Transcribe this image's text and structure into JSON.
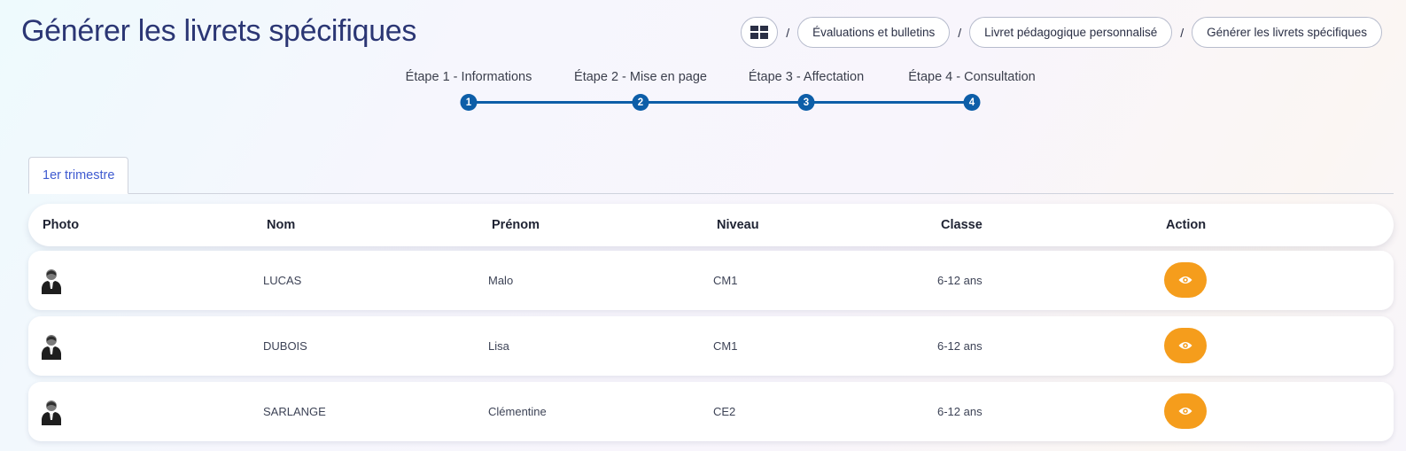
{
  "page": {
    "title": "Générer les livrets spécifiques"
  },
  "breadcrumb": {
    "home_icon": "dashboard-grid-icon",
    "separator": "/",
    "items": [
      {
        "label": "Évaluations et bulletins"
      },
      {
        "label": "Livret pédagogique personnalisé"
      },
      {
        "label": "Générer les livrets spécifiques"
      }
    ]
  },
  "stepper": {
    "steps": [
      {
        "label": "Étape 1 - Informations",
        "number": "1"
      },
      {
        "label": "Étape 2 - Mise en page",
        "number": "2"
      },
      {
        "label": "Étape 3 - Affectation",
        "number": "3"
      },
      {
        "label": "Étape 4 - Consultation",
        "number": "4"
      }
    ],
    "color": "#0d5ea8"
  },
  "tabs": [
    {
      "label": "1er trimestre",
      "active": true
    }
  ],
  "table": {
    "headers": {
      "photo": "Photo",
      "nom": "Nom",
      "prenom": "Prénom",
      "niveau": "Niveau",
      "classe": "Classe",
      "action": "Action"
    },
    "rows": [
      {
        "nom": "LUCAS",
        "prenom": "Malo",
        "niveau": "CM1",
        "classe": "6-12 ans"
      },
      {
        "nom": "DUBOIS",
        "prenom": "Lisa",
        "niveau": "CM1",
        "classe": "6-12 ans"
      },
      {
        "nom": "SARLANGE",
        "prenom": "Clémentine",
        "niveau": "CE2",
        "classe": "6-12 ans"
      }
    ],
    "action_icon": "eye-icon",
    "action_color": "#f59d1c"
  },
  "colors": {
    "title": "#2b3674",
    "accent": "#0d5ea8",
    "tab_text": "#3f5bd0"
  }
}
